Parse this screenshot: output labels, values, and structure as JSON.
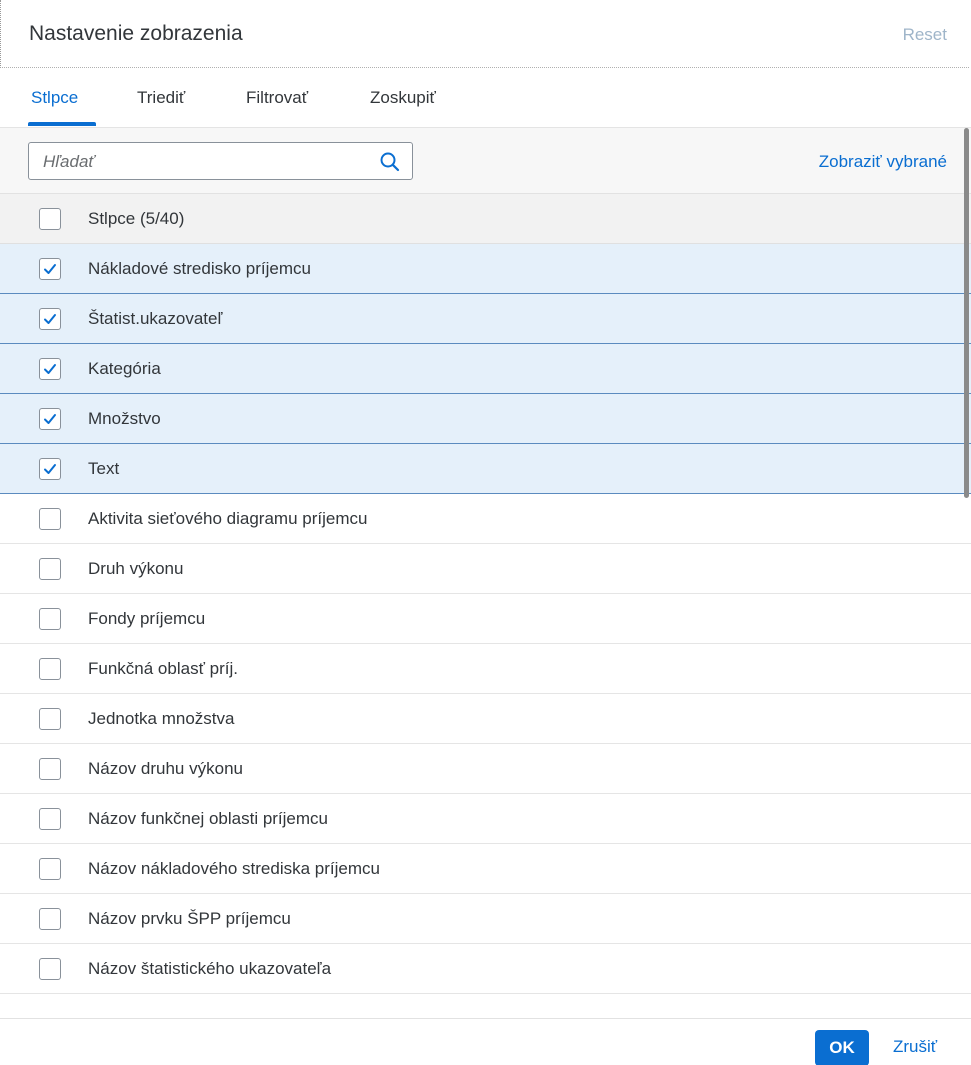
{
  "dialog": {
    "title": "Nastavenie zobrazenia",
    "reset_label": "Reset"
  },
  "tabs": [
    {
      "label": "Stlpce",
      "active": true
    },
    {
      "label": "Triediť",
      "active": false
    },
    {
      "label": "Filtrovať",
      "active": false
    },
    {
      "label": "Zoskupiť",
      "active": false
    }
  ],
  "toolbar": {
    "search_placeholder": "Hľadať",
    "show_selected_label": "Zobraziť vybrané"
  },
  "list": {
    "header_label": "Stlpce (5/40)",
    "items": [
      {
        "label": "Nákladové stredisko príjemcu",
        "checked": true
      },
      {
        "label": "Štatist.ukazovateľ",
        "checked": true
      },
      {
        "label": "Kategória",
        "checked": true
      },
      {
        "label": "Množstvo",
        "checked": true
      },
      {
        "label": "Text",
        "checked": true
      },
      {
        "label": "Aktivita sieťového diagramu príjemcu",
        "checked": false
      },
      {
        "label": "Druh výkonu",
        "checked": false
      },
      {
        "label": "Fondy príjemcu",
        "checked": false
      },
      {
        "label": "Funkčná oblasť príj.",
        "checked": false
      },
      {
        "label": "Jednotka množstva",
        "checked": false
      },
      {
        "label": "Názov druhu výkonu",
        "checked": false
      },
      {
        "label": "Názov funkčnej oblasti príjemcu",
        "checked": false
      },
      {
        "label": "Názov nákladového strediska príjemcu",
        "checked": false
      },
      {
        "label": "Názov prvku ŠPP príjemcu",
        "checked": false
      },
      {
        "label": "Názov štatistického ukazovateľa",
        "checked": false
      }
    ]
  },
  "footer": {
    "ok_label": "OK",
    "cancel_label": "Zrušiť"
  },
  "colors": {
    "accent": "#0a6ed1",
    "selected_row": "#e5f0fa",
    "selected_border": "#5b8bbf",
    "reset_disabled": "#9fb5c9"
  }
}
